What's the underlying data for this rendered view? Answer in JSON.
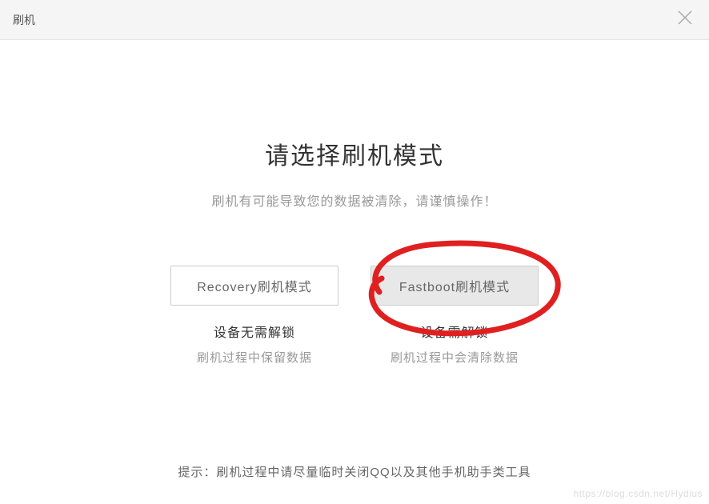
{
  "titlebar": {
    "title": "刷机"
  },
  "main": {
    "heading": "请选择刷机模式",
    "subheading": "刷机有可能导致您的数据被清除，请谨慎操作！"
  },
  "options": {
    "recovery": {
      "button": "Recovery刷机模式",
      "title": "设备无需解锁",
      "desc": "刷机过程中保留数据"
    },
    "fastboot": {
      "button": "Fastboot刷机模式",
      "title": "设备需解锁",
      "desc": "刷机过程中会清除数据"
    }
  },
  "tip": "提示：刷机过程中请尽量临时关闭QQ以及其他手机助手类工具",
  "watermark": "https://blog.csdn.net/Hydius"
}
